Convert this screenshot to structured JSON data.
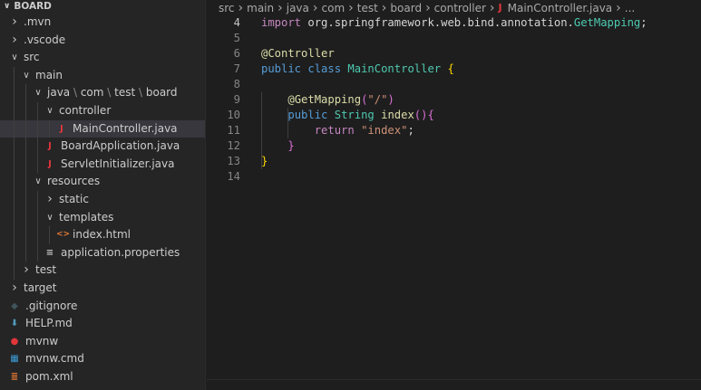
{
  "explorer": {
    "root_label": "BOARD",
    "items": [
      {
        "label": ".mvn",
        "type": "folder",
        "expanded": false,
        "depth": 0
      },
      {
        "label": ".vscode",
        "type": "folder",
        "expanded": false,
        "depth": 0
      },
      {
        "label": "src",
        "type": "folder",
        "expanded": true,
        "depth": 0
      },
      {
        "label": "main",
        "type": "folder",
        "expanded": true,
        "depth": 1
      },
      {
        "label": "java",
        "type": "folder",
        "expanded": true,
        "depth": 2,
        "compact": [
          "java",
          "com",
          "test",
          "board"
        ]
      },
      {
        "label": "controller",
        "type": "folder",
        "expanded": true,
        "depth": 3
      },
      {
        "label": "MainController.java",
        "type": "java",
        "depth": 4,
        "selected": true
      },
      {
        "label": "BoardApplication.java",
        "type": "java",
        "depth": 3
      },
      {
        "label": "ServletInitializer.java",
        "type": "java",
        "depth": 3
      },
      {
        "label": "resources",
        "type": "folder",
        "expanded": true,
        "depth": 2
      },
      {
        "label": "static",
        "type": "folder",
        "expanded": false,
        "depth": 3
      },
      {
        "label": "templates",
        "type": "folder",
        "expanded": true,
        "depth": 3
      },
      {
        "label": "index.html",
        "type": "html",
        "depth": 4
      },
      {
        "label": "application.properties",
        "type": "properties",
        "depth": 3
      },
      {
        "label": "test",
        "type": "folder",
        "expanded": false,
        "depth": 1
      },
      {
        "label": "target",
        "type": "folder",
        "expanded": false,
        "depth": 0
      },
      {
        "label": ".gitignore",
        "type": "git",
        "depth": 0
      },
      {
        "label": "HELP.md",
        "type": "md",
        "depth": 0
      },
      {
        "label": "mvnw",
        "type": "mvnw",
        "depth": 0
      },
      {
        "label": "mvnw.cmd",
        "type": "cmd",
        "depth": 0
      },
      {
        "label": "pom.xml",
        "type": "xml",
        "depth": 0
      }
    ]
  },
  "breadcrumb": [
    "src",
    "main",
    "java",
    "com",
    "test",
    "board",
    "controller",
    "MainController.java",
    "..."
  ],
  "code": {
    "lines": [
      {
        "n": "4",
        "active": true,
        "tokens": [
          [
            "kw2",
            "import"
          ],
          [
            "pkg",
            " org.springframework.web.bind.annotation."
          ],
          [
            "ty",
            "GetMapping"
          ],
          [
            "pkg",
            ";"
          ]
        ]
      },
      {
        "n": "5",
        "tokens": []
      },
      {
        "n": "6",
        "tokens": [
          [
            "ann",
            "@Controller"
          ]
        ]
      },
      {
        "n": "7",
        "tokens": [
          [
            "kw",
            "public"
          ],
          [
            "pkg",
            " "
          ],
          [
            "kw",
            "class"
          ],
          [
            "pkg",
            " "
          ],
          [
            "ty",
            "MainController"
          ],
          [
            "pkg",
            " "
          ],
          [
            "br1",
            "{"
          ]
        ]
      },
      {
        "n": "8",
        "tokens": []
      },
      {
        "n": "9",
        "tokens": [
          [
            "pkg",
            "    "
          ],
          [
            "ann",
            "@GetMapping"
          ],
          [
            "br2",
            "("
          ],
          [
            "st",
            "\"/\""
          ],
          [
            "br2",
            ")"
          ]
        ]
      },
      {
        "n": "10",
        "tokens": [
          [
            "pkg",
            "    "
          ],
          [
            "kw",
            "public"
          ],
          [
            "pkg",
            " "
          ],
          [
            "ty",
            "String"
          ],
          [
            "pkg",
            " "
          ],
          [
            "fn",
            "index"
          ],
          [
            "br2",
            "()"
          ],
          [
            "br2",
            "{"
          ]
        ]
      },
      {
        "n": "11",
        "tokens": [
          [
            "pkg",
            "        "
          ],
          [
            "kw2",
            "return"
          ],
          [
            "pkg",
            " "
          ],
          [
            "st",
            "\"index\""
          ],
          [
            "pkg",
            ";"
          ]
        ]
      },
      {
        "n": "12",
        "tokens": [
          [
            "pkg",
            "    "
          ],
          [
            "br2",
            "}"
          ]
        ]
      },
      {
        "n": "13",
        "tokens": [
          [
            "br1",
            "}"
          ]
        ]
      },
      {
        "n": "14",
        "tokens": []
      }
    ]
  },
  "colors": {
    "java_icon": "#e0363a",
    "html_icon": "#e37933",
    "git_icon": "#41535b",
    "md_icon": "#519aba",
    "mvnw_icon": "#e0363a",
    "cmd_icon": "#3b9bd4",
    "xml_icon": "#e37933",
    "properties_icon": "#c5c5c5"
  }
}
